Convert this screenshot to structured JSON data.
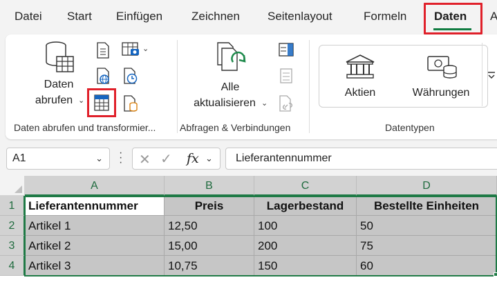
{
  "menu": {
    "tabs": [
      "Datei",
      "Start",
      "Einfügen",
      "Zeichnen",
      "Seitenlayout",
      "Formeln",
      "Daten",
      "A"
    ],
    "active_tab": "Daten"
  },
  "ribbon": {
    "get_data": {
      "button_line1": "Daten",
      "button_line2": "abrufen",
      "group_label": "Daten abrufen und transformier..."
    },
    "queries": {
      "button_line1": "Alle",
      "button_line2": "aktualisieren",
      "group_label": "Abfragen & Verbindungen"
    },
    "datatypes": {
      "stocks_label": "Aktien",
      "currencies_label": "Währungen",
      "group_label": "Datentypen"
    }
  },
  "formula_bar": {
    "name_box": "A1",
    "formula": "Lieferantennummer"
  },
  "sheet": {
    "columns": [
      "A",
      "B",
      "C",
      "D"
    ],
    "rows": [
      "1",
      "2",
      "3",
      "4"
    ],
    "cells": [
      [
        "Lieferantennummer",
        "Preis",
        "Lagerbestand",
        "Bestellte Einheiten"
      ],
      [
        "Artikel 1",
        "12,50",
        "100",
        "50"
      ],
      [
        "Artikel 2",
        "15,00",
        "200",
        "75"
      ],
      [
        "Artikel 3",
        "10,75",
        "150",
        "60"
      ]
    ]
  },
  "colors": {
    "accent": "#107c41",
    "highlight": "#e0202a",
    "selection": "#c6c6c6"
  },
  "icons": {
    "get_data": "database-table-icon",
    "refresh_all": "refresh-pages-icon",
    "stocks": "bank-icon",
    "currencies": "money-coins-icon"
  }
}
